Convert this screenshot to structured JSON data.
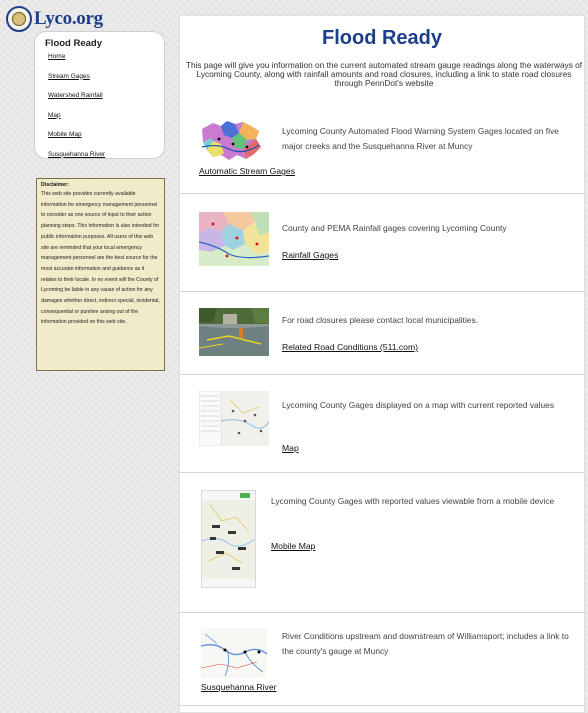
{
  "logo": {
    "text": "Lyco.org",
    "icon": "county-seal-icon"
  },
  "sidebar": {
    "title": "Flood Ready",
    "links": [
      "Home",
      "Stream Gages",
      "Watershed Rainfall",
      "Map",
      "Mobile Map",
      "Susquehanna River"
    ]
  },
  "disclaimer": {
    "title": "Disclaimer:",
    "body": "This web site provides currently available information for emergency management personnel to consider as one source of input to their action planning steps. This information is also intended for public information purposes. All users of this web site are reminded that your local emergency management personnel are the best source for the most accurate information and guidance as it relates to their locale. In no event will the County of Lycoming be liable in any cause of action for any damages whether direct, indirect special, incidental, consequential or punitive arising out of the information provided on this web site."
  },
  "main": {
    "title": "Flood Ready",
    "intro": "This page will give you information on the current automated stream gauge readings along the waterways of Lycoming County, along with rainfall amounts and road closures, including a link to state road closures through PennDot's website",
    "sections": [
      {
        "description": "Lycoming County Automated Flood Warning System Gages located on five major creeks and the Susquehanna River at Muncy",
        "link": "Automatic Stream Gages",
        "thumb": "stream-gages-map-thumbnail"
      },
      {
        "description": "County and PEMA Rainfall gages covering Lycoming County",
        "link": "Rainfall Gages",
        "thumb": "rainfall-map-thumbnail"
      },
      {
        "description": "For road closures please contact local municipalities.",
        "link": "Related Road Conditions (511.com)",
        "thumb": "flooded-road-photo-thumbnail"
      },
      {
        "description": "Lycoming County Gages displayed on a map with current reported values",
        "link": "Map",
        "thumb": "gage-map-screenshot-thumbnail"
      },
      {
        "description": "Lycoming County Gages with reported values viewable from a mobile device",
        "link": "Mobile Map",
        "thumb": "mobile-map-screenshot-thumbnail"
      },
      {
        "description": "River Conditions upstream and downstream of Williamsport; includes a link to the county's gauge at Muncy",
        "link": "Susquehanna River",
        "thumb": "river-map-thumbnail"
      }
    ]
  },
  "colors": {
    "title_blue": "#1d3f8a",
    "disclaimer_bg": "#f0ebc8",
    "page_bg": "#ececec"
  }
}
